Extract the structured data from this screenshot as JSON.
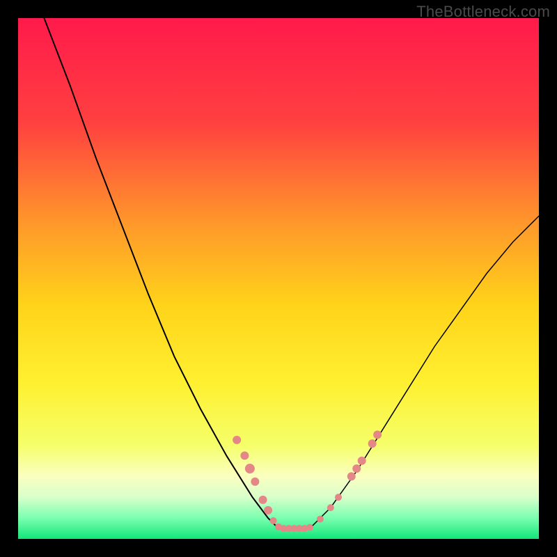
{
  "watermark": "TheBottleneck.com",
  "chart_data": {
    "type": "line",
    "title": "",
    "xlabel": "",
    "ylabel": "",
    "xlim": [
      0,
      100
    ],
    "ylim": [
      0,
      100
    ],
    "grid": false,
    "legend": false,
    "background": {
      "type": "vertical-gradient",
      "stops": [
        {
          "pos": 0.0,
          "color": "#ff1a4b"
        },
        {
          "pos": 0.2,
          "color": "#ff4040"
        },
        {
          "pos": 0.4,
          "color": "#ff9a2a"
        },
        {
          "pos": 0.55,
          "color": "#ffd31a"
        },
        {
          "pos": 0.7,
          "color": "#fff030"
        },
        {
          "pos": 0.82,
          "color": "#f5ff6a"
        },
        {
          "pos": 0.88,
          "color": "#faffc0"
        },
        {
          "pos": 0.92,
          "color": "#d8ffca"
        },
        {
          "pos": 0.96,
          "color": "#7affb0"
        },
        {
          "pos": 1.0,
          "color": "#12e67a"
        }
      ]
    },
    "series": [
      {
        "name": "left-curve",
        "color": "#000000",
        "width": 2,
        "x": [
          5,
          10,
          15,
          20,
          25,
          30,
          35,
          40,
          45,
          48,
          50
        ],
        "y": [
          100,
          87,
          73,
          60,
          47,
          35,
          25,
          16,
          8,
          4,
          2
        ]
      },
      {
        "name": "right-curve",
        "color": "#000000",
        "width": 1.5,
        "x": [
          56,
          60,
          65,
          70,
          75,
          80,
          85,
          90,
          95,
          100
        ],
        "y": [
          2,
          6,
          13,
          21,
          29,
          37,
          44,
          51,
          57,
          62
        ]
      }
    ],
    "bottom_segment": {
      "color": "#000000",
      "width": 1.5,
      "x": [
        50,
        56
      ],
      "y": [
        2,
        2
      ]
    },
    "markers": {
      "color": "#e38787",
      "radius_small": 5,
      "radius_large": 7,
      "points": [
        {
          "x": 42,
          "y": 19,
          "r": 6
        },
        {
          "x": 43.5,
          "y": 16,
          "r": 6
        },
        {
          "x": 44.5,
          "y": 13.5,
          "r": 7
        },
        {
          "x": 45.5,
          "y": 11,
          "r": 6
        },
        {
          "x": 47,
          "y": 7.5,
          "r": 6
        },
        {
          "x": 48,
          "y": 5.5,
          "r": 6
        },
        {
          "x": 49,
          "y": 3.5,
          "r": 5
        },
        {
          "x": 50,
          "y": 2.3,
          "r": 5
        },
        {
          "x": 51,
          "y": 2.0,
          "r": 5
        },
        {
          "x": 52,
          "y": 2.0,
          "r": 5
        },
        {
          "x": 53,
          "y": 2.0,
          "r": 5
        },
        {
          "x": 54,
          "y": 2.0,
          "r": 5
        },
        {
          "x": 55,
          "y": 2.0,
          "r": 5
        },
        {
          "x": 56,
          "y": 2.2,
          "r": 5
        },
        {
          "x": 58,
          "y": 3.8,
          "r": 5
        },
        {
          "x": 60,
          "y": 6.0,
          "r": 5
        },
        {
          "x": 61.5,
          "y": 8.0,
          "r": 5
        },
        {
          "x": 64,
          "y": 12.0,
          "r": 6
        },
        {
          "x": 65,
          "y": 13.5,
          "r": 6
        },
        {
          "x": 66,
          "y": 15.0,
          "r": 6
        },
        {
          "x": 68,
          "y": 18.3,
          "r": 6
        },
        {
          "x": 69,
          "y": 20.0,
          "r": 6
        }
      ]
    }
  }
}
